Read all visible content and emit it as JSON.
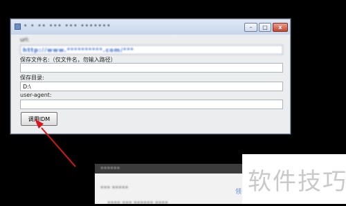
{
  "window": {
    "title": "• • •• ••• ••• •••••••",
    "minimize_glyph": "–",
    "maximize_glyph": "□",
    "close_glyph": "x"
  },
  "form": {
    "url_label": "url:",
    "url_value": "http://www.**********.com/***",
    "filename_label": "保存文件名:（仅文件名，勿输入路径）",
    "filename_value": "",
    "dir_label": "保存目录:",
    "dir_value": "D:\\",
    "ua_label": "user-agent:",
    "ua_value": "",
    "call_button": "调用IDM"
  },
  "background_window": {
    "title": "••••••",
    "line1": "••• •••••",
    "line2": "•••• ••• •••••• ••••",
    "link": "领"
  },
  "watermark": {
    "text": "软件技巧"
  },
  "colors": {
    "arrow": "#d8141e",
    "url_text": "#2b63c9",
    "link": "#5b8fd6"
  }
}
